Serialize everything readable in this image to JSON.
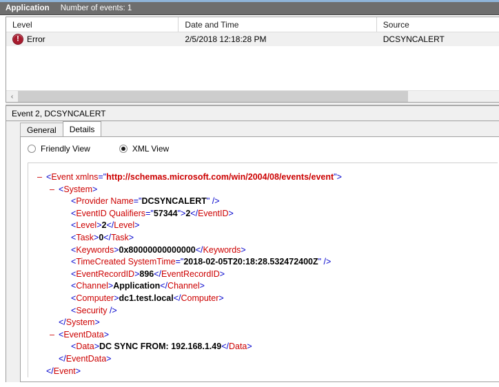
{
  "channel_bar": {
    "channel_name": "Application",
    "event_count_label": "Number of events: 1"
  },
  "events_list": {
    "columns": [
      "Level",
      "Date and Time",
      "Source"
    ],
    "rows": [
      {
        "level": "Error",
        "level_icon": "error-icon",
        "date_time": "2/5/2018 12:18:28 PM",
        "source": "DCSYNCALERT"
      }
    ],
    "scrollbar": {
      "left_arrow": "‹"
    }
  },
  "detail_pane": {
    "title": "Event 2, DCSYNCALERT",
    "tabs": [
      {
        "label": "General",
        "active": false
      },
      {
        "label": "Details",
        "active": true
      }
    ],
    "view_options": [
      {
        "label": "Friendly View",
        "checked": false
      },
      {
        "label": "XML View",
        "checked": true
      }
    ]
  },
  "xml": {
    "lines": [
      {
        "indent": 0,
        "minus": true,
        "parts": [
          {
            "t": "punct",
            "v": "<"
          },
          {
            "t": "tag",
            "v": "Event"
          },
          {
            "t": "punct",
            "v": " "
          },
          {
            "t": "attr",
            "v": "xmlns"
          },
          {
            "t": "punct",
            "v": "=\""
          },
          {
            "t": "val",
            "v": "http://schemas.microsoft.com/win/2004/08/events/event"
          },
          {
            "t": "punct",
            "v": "\">"
          }
        ]
      },
      {
        "indent": 1,
        "minus": true,
        "parts": [
          {
            "t": "punct",
            "v": "<"
          },
          {
            "t": "tag",
            "v": "System"
          },
          {
            "t": "punct",
            "v": ">"
          }
        ]
      },
      {
        "indent": 2,
        "minus": false,
        "parts": [
          {
            "t": "punct",
            "v": "<"
          },
          {
            "t": "tag",
            "v": "Provider"
          },
          {
            "t": "punct",
            "v": " "
          },
          {
            "t": "attr",
            "v": "Name"
          },
          {
            "t": "punct",
            "v": "=\""
          },
          {
            "t": "valdk",
            "v": "DCSYNCALERT"
          },
          {
            "t": "punct",
            "v": "\" />"
          }
        ]
      },
      {
        "indent": 2,
        "minus": false,
        "parts": [
          {
            "t": "punct",
            "v": "<"
          },
          {
            "t": "tag",
            "v": "EventID"
          },
          {
            "t": "punct",
            "v": " "
          },
          {
            "t": "attr",
            "v": "Qualifiers"
          },
          {
            "t": "punct",
            "v": "=\""
          },
          {
            "t": "valdk",
            "v": "57344"
          },
          {
            "t": "punct",
            "v": "\">"
          },
          {
            "t": "text",
            "v": "2"
          },
          {
            "t": "punct",
            "v": "</"
          },
          {
            "t": "tag",
            "v": "EventID"
          },
          {
            "t": "punct",
            "v": ">"
          }
        ]
      },
      {
        "indent": 2,
        "minus": false,
        "parts": [
          {
            "t": "punct",
            "v": "<"
          },
          {
            "t": "tag",
            "v": "Level"
          },
          {
            "t": "punct",
            "v": ">"
          },
          {
            "t": "text",
            "v": "2"
          },
          {
            "t": "punct",
            "v": "</"
          },
          {
            "t": "tag",
            "v": "Level"
          },
          {
            "t": "punct",
            "v": ">"
          }
        ]
      },
      {
        "indent": 2,
        "minus": false,
        "parts": [
          {
            "t": "punct",
            "v": "<"
          },
          {
            "t": "tag",
            "v": "Task"
          },
          {
            "t": "punct",
            "v": ">"
          },
          {
            "t": "text",
            "v": "0"
          },
          {
            "t": "punct",
            "v": "</"
          },
          {
            "t": "tag",
            "v": "Task"
          },
          {
            "t": "punct",
            "v": ">"
          }
        ]
      },
      {
        "indent": 2,
        "minus": false,
        "parts": [
          {
            "t": "punct",
            "v": "<"
          },
          {
            "t": "tag",
            "v": "Keywords"
          },
          {
            "t": "punct",
            "v": ">"
          },
          {
            "t": "text",
            "v": "0x80000000000000"
          },
          {
            "t": "punct",
            "v": "</"
          },
          {
            "t": "tag",
            "v": "Keywords"
          },
          {
            "t": "punct",
            "v": ">"
          }
        ]
      },
      {
        "indent": 2,
        "minus": false,
        "parts": [
          {
            "t": "punct",
            "v": "<"
          },
          {
            "t": "tag",
            "v": "TimeCreated"
          },
          {
            "t": "punct",
            "v": " "
          },
          {
            "t": "attr",
            "v": "SystemTime"
          },
          {
            "t": "punct",
            "v": "=\""
          },
          {
            "t": "valdk",
            "v": "2018-02-05T20:18:28.532472400Z"
          },
          {
            "t": "punct",
            "v": "\" />"
          }
        ]
      },
      {
        "indent": 2,
        "minus": false,
        "parts": [
          {
            "t": "punct",
            "v": "<"
          },
          {
            "t": "tag",
            "v": "EventRecordID"
          },
          {
            "t": "punct",
            "v": ">"
          },
          {
            "t": "text",
            "v": "896"
          },
          {
            "t": "punct",
            "v": "</"
          },
          {
            "t": "tag",
            "v": "EventRecordID"
          },
          {
            "t": "punct",
            "v": ">"
          }
        ]
      },
      {
        "indent": 2,
        "minus": false,
        "parts": [
          {
            "t": "punct",
            "v": "<"
          },
          {
            "t": "tag",
            "v": "Channel"
          },
          {
            "t": "punct",
            "v": ">"
          },
          {
            "t": "text",
            "v": "Application"
          },
          {
            "t": "punct",
            "v": "</"
          },
          {
            "t": "tag",
            "v": "Channel"
          },
          {
            "t": "punct",
            "v": ">"
          }
        ]
      },
      {
        "indent": 2,
        "minus": false,
        "parts": [
          {
            "t": "punct",
            "v": "<"
          },
          {
            "t": "tag",
            "v": "Computer"
          },
          {
            "t": "punct",
            "v": ">"
          },
          {
            "t": "text",
            "v": "dc1.test.local"
          },
          {
            "t": "punct",
            "v": "</"
          },
          {
            "t": "tag",
            "v": "Computer"
          },
          {
            "t": "punct",
            "v": ">"
          }
        ]
      },
      {
        "indent": 2,
        "minus": false,
        "parts": [
          {
            "t": "punct",
            "v": "<"
          },
          {
            "t": "tag",
            "v": "Security"
          },
          {
            "t": "punct",
            "v": " />"
          }
        ]
      },
      {
        "indent": 1,
        "minus": false,
        "parts": [
          {
            "t": "punct",
            "v": "</"
          },
          {
            "t": "tag",
            "v": "System"
          },
          {
            "t": "punct",
            "v": ">"
          }
        ]
      },
      {
        "indent": 1,
        "minus": true,
        "parts": [
          {
            "t": "punct",
            "v": "<"
          },
          {
            "t": "tag",
            "v": "EventData"
          },
          {
            "t": "punct",
            "v": ">"
          }
        ]
      },
      {
        "indent": 2,
        "minus": false,
        "parts": [
          {
            "t": "punct",
            "v": "<"
          },
          {
            "t": "tag",
            "v": "Data"
          },
          {
            "t": "punct",
            "v": ">"
          },
          {
            "t": "text",
            "v": "DC SYNC FROM: 192.168.1.49"
          },
          {
            "t": "punct",
            "v": "</"
          },
          {
            "t": "tag",
            "v": "Data"
          },
          {
            "t": "punct",
            "v": ">"
          }
        ]
      },
      {
        "indent": 1,
        "minus": false,
        "parts": [
          {
            "t": "punct",
            "v": "</"
          },
          {
            "t": "tag",
            "v": "EventData"
          },
          {
            "t": "punct",
            "v": ">"
          }
        ]
      },
      {
        "indent": 0,
        "minus": false,
        "parts": [
          {
            "t": "punct",
            "v": "</"
          },
          {
            "t": "tag",
            "v": "Event"
          },
          {
            "t": "punct",
            "v": ">"
          }
        ]
      }
    ]
  },
  "colors": {
    "channel_bar_bg": "#6e6e6e",
    "top_strip": "#8fb4d9",
    "error_red": "#a81b2e",
    "xml_tag_red": "#cc0000",
    "xml_punct_blue": "#0000cc",
    "row_selected_bg": "#f0f0f0"
  }
}
